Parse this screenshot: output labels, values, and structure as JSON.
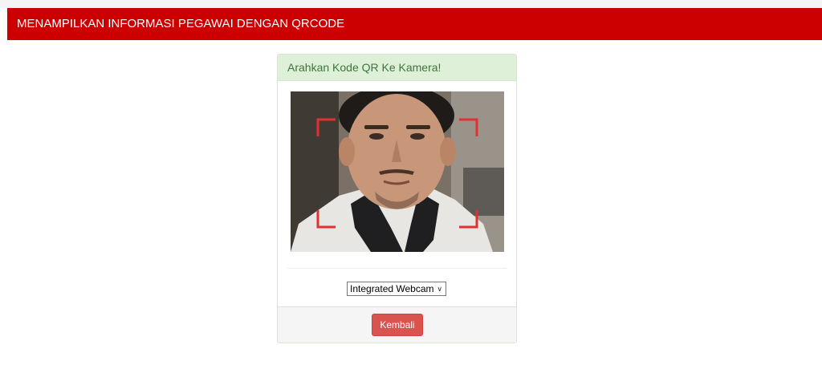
{
  "header": {
    "title": "MENAMPILKAN INFORMASI PEGAWAI DENGAN QRCODE"
  },
  "panel": {
    "heading": "Arahkan Kode QR Ke Kamera!",
    "camera_select": {
      "selected": "Integrated Webcam"
    },
    "back_button_label": "Kembali"
  },
  "colors": {
    "navbar": "#cc0000",
    "panel_heading_bg": "#dff0d8",
    "panel_heading_text": "#3c763d",
    "danger_button": "#d9534f",
    "scan_corners": "#e03030"
  },
  "icons": {
    "select_arrow": "chevron-down-icon"
  }
}
